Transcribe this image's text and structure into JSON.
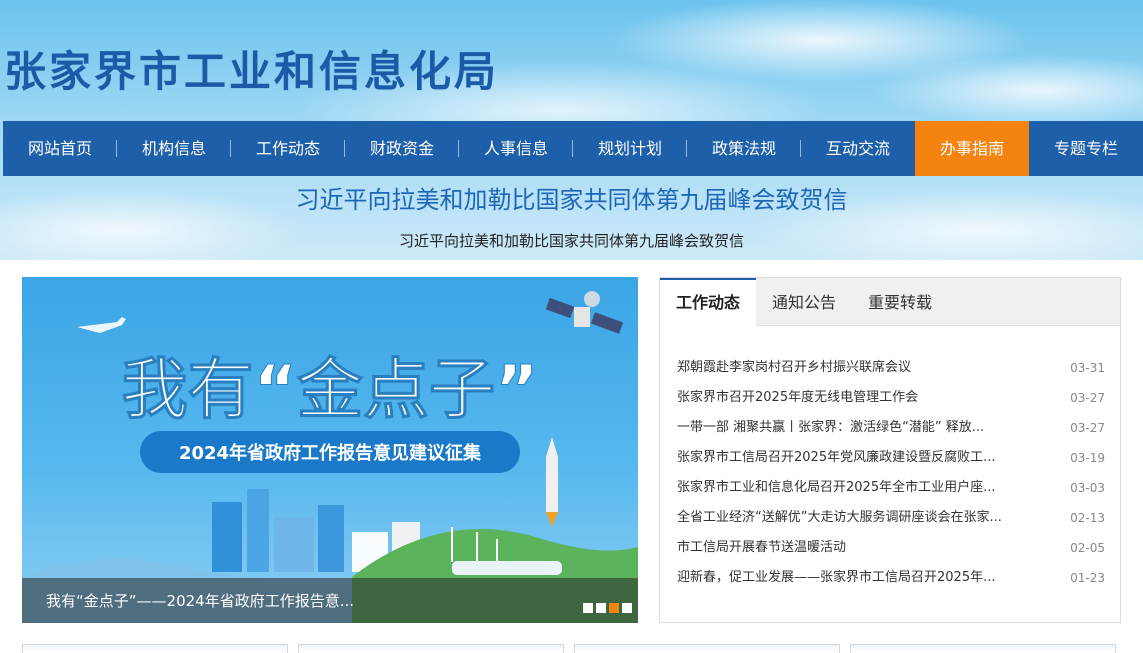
{
  "header": {
    "site_title": "张家界市工业和信息化局"
  },
  "nav": {
    "items": [
      {
        "label": "网站首页"
      },
      {
        "label": "机构信息"
      },
      {
        "label": "工作动态"
      },
      {
        "label": "财政资金"
      },
      {
        "label": "人事信息"
      },
      {
        "label": "规划计划"
      },
      {
        "label": "政策法规"
      },
      {
        "label": "互动交流"
      },
      {
        "label": "办事指南"
      },
      {
        "label": "专题专栏"
      }
    ],
    "active_color": "#f4830f",
    "bar_color": "#1d5fa8"
  },
  "headline": {
    "title": "习近平向拉美和加勒比国家共同体第九届峰会致贺信",
    "subtitle": "习近平向拉美和加勒比国家共同体第九届峰会致贺信"
  },
  "banner": {
    "big_text": "我有“金点子”",
    "sub_text": "2024年省政府工作报告意见建议征集",
    "caption": "我有“金点子”——2024年省政府工作报告意...",
    "slides": 4,
    "active_slide": 3
  },
  "news": {
    "tabs": [
      {
        "label": "工作动态"
      },
      {
        "label": "通知公告"
      },
      {
        "label": "重要转载"
      }
    ],
    "items": [
      {
        "title": "郑朝霞赴李家岗村召开乡村振兴联席会议",
        "date": "03-31"
      },
      {
        "title": "张家界市召开2025年度无线电管理工作会",
        "date": "03-27"
      },
      {
        "title": "一带一部 湘聚共赢丨张家界：激活绿色“潜能” 释放...",
        "date": "03-27"
      },
      {
        "title": "张家界市工信局召开2025年党风廉政建设暨反腐败工...",
        "date": "03-19"
      },
      {
        "title": "张家界市工业和信息化局召开2025年全市工业用户座...",
        "date": "03-03"
      },
      {
        "title": "全省工业经济“送解优”大走访大服务调研座谈会在张家...",
        "date": "02-13"
      },
      {
        "title": "市工信局开展春节送温暖活动",
        "date": "02-05"
      },
      {
        "title": "迎新春，促工业发展——张家界市工信局召开2025年...",
        "date": "01-23"
      }
    ]
  }
}
